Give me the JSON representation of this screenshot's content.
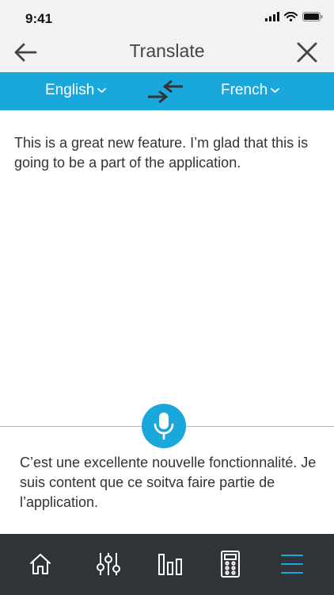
{
  "status_bar": {
    "time": "9:41",
    "icons": [
      "signal-icon",
      "wifi-icon",
      "battery-icon"
    ]
  },
  "header": {
    "title": "Translate",
    "back_icon": "arrow-left-icon",
    "close_icon": "close-icon"
  },
  "language_bar": {
    "source_language": "English",
    "target_language": "French",
    "swap_icon": "swap-arrows-icon",
    "background_color": "#1aa8dc"
  },
  "source_text": "This is a great new feature. I’m glad that this is going to be a part of the application.",
  "mic": {
    "icon": "microphone-icon",
    "color": "#1aa8dc"
  },
  "translated_text": "C’est une excellente nouvelle fonctionnalité. Je suis content que ce soitva faire partie de l’application.",
  "tab_bar": {
    "background_color": "#303338",
    "active_color": "#1aa8dc",
    "tabs": [
      {
        "icon": "home-icon",
        "active": false
      },
      {
        "icon": "sliders-icon",
        "active": false
      },
      {
        "icon": "bar-chart-icon",
        "active": false
      },
      {
        "icon": "remote-icon",
        "active": false
      },
      {
        "icon": "menu-icon",
        "active": true
      }
    ]
  }
}
